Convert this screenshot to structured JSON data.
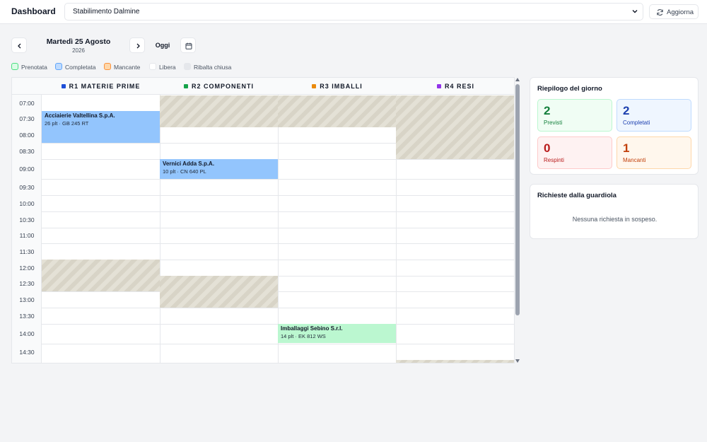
{
  "header": {
    "title": "Dashboard",
    "site_selected": "Stabilimento Dalmine",
    "refresh_label": "Aggiorna"
  },
  "date_nav": {
    "date_label": "Martedì 25 Agosto",
    "year_label": "2026",
    "today_label": "Oggi"
  },
  "legend": [
    {
      "label": "Prenotata",
      "fill": "#dcfce7",
      "border": "#4ade80"
    },
    {
      "label": "Completata",
      "fill": "#bfdbfe",
      "border": "#60a5fa"
    },
    {
      "label": "Mancante",
      "fill": "#fed7aa",
      "border": "#fb923c"
    },
    {
      "label": "Libera",
      "fill": "#ffffff",
      "border": "#e5e7eb"
    },
    {
      "label": "Ribalta chiusa",
      "fill": "#e5e7eb",
      "border": "#e5e7eb"
    }
  ],
  "resources": [
    {
      "label": "R1 MATERIE PRIME",
      "color": "#1d4ed8"
    },
    {
      "label": "R2 COMPONENTI",
      "color": "#16a34a"
    },
    {
      "label": "R3 IMBALLI",
      "color": "#ea8a0c"
    },
    {
      "label": "R4 RESI",
      "color": "#9333ea"
    }
  ],
  "time_slots": [
    "07:00",
    "07:30",
    "08:00",
    "08:30",
    "09:00",
    "09:30",
    "10:00",
    "10:30",
    "11:00",
    "11:30",
    "12:00",
    "12:30",
    "13:00",
    "13:30",
    "14:00",
    "14:30"
  ],
  "bookings": [
    {
      "name": "Acciaierie Valtellina S.p.A.",
      "detail": "26 plt · GB 245 RT",
      "status": "Completata"
    },
    {
      "name": "Vernici Adda S.p.A.",
      "detail": "10 plt · CN 640 PL",
      "status": "Completata"
    },
    {
      "name": "Imballaggi Sebino S.r.l.",
      "detail": "14 plt · EK 812 WS",
      "status": "Prenotata"
    }
  ],
  "summary": {
    "title": "Riepilogo del giorno",
    "stats": [
      {
        "value": "2",
        "label": "Previsti",
        "color": "#15803d",
        "bg": "#f0fdf4",
        "border": "#bbf7d0"
      },
      {
        "value": "2",
        "label": "Completati",
        "color": "#1e40af",
        "bg": "#eff6ff",
        "border": "#bfdbfe"
      },
      {
        "value": "0",
        "label": "Respinti",
        "color": "#b91c1c",
        "bg": "#fef2f2",
        "border": "#fecaca"
      },
      {
        "value": "1",
        "label": "Mancanti",
        "color": "#c2410c",
        "bg": "#fff7ed",
        "border": "#fed7aa"
      }
    ]
  },
  "guard_requests": {
    "title": "Richieste dalla guardiola",
    "empty_message": "Nessuna richiesta in sospeso."
  }
}
